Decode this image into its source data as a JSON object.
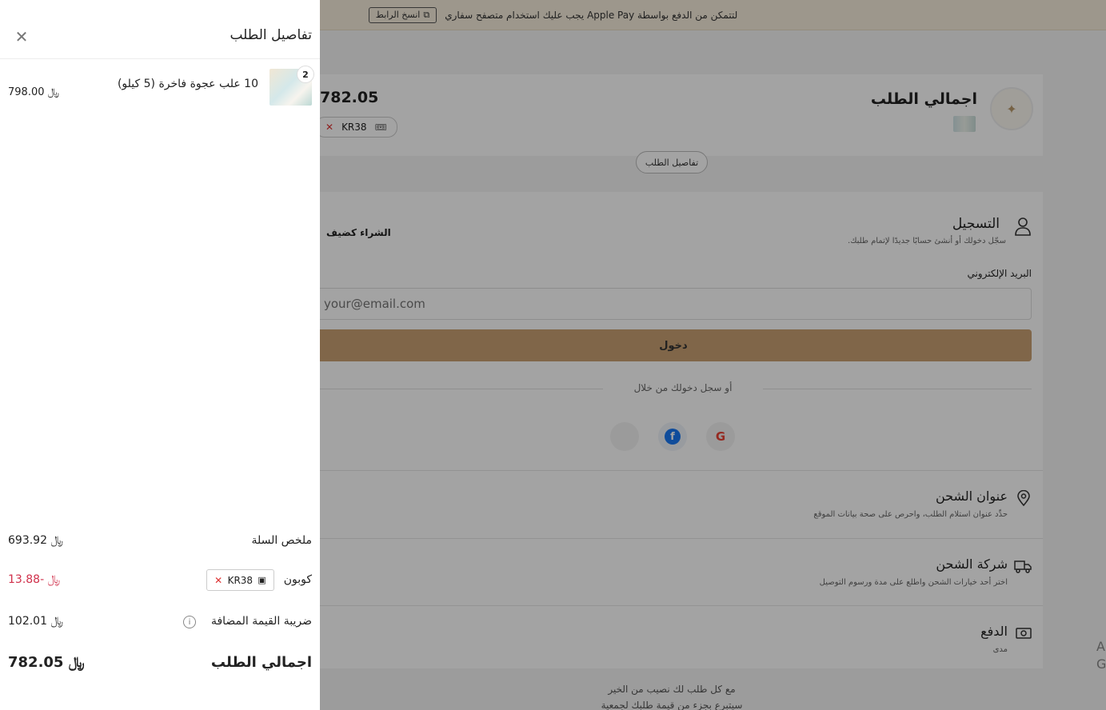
{
  "banner": {
    "message": "لتتمكن من الدفع بواسطة Apple Pay يجب عليك استخدام متصفح سفاري",
    "copy_link_label": "انسخ الرابط"
  },
  "order_summary": {
    "title": "اجمالي الطلب",
    "total": "782.05",
    "coupon_code": "KR38",
    "details_button": "تفاصيل الطلب"
  },
  "registration": {
    "title": "التسجيل",
    "subtitle": "سجّل دخولك أو أنشئ حسابًا جديدًا لإتمام طلبك.",
    "guest_label": "الشراء كضيف",
    "email_label": "البريد الإلكتروني",
    "email_placeholder": "your@email.com",
    "login_button": "دخول",
    "or_text": "أو سجل دخولك من خلال"
  },
  "sections": [
    {
      "title": "عنوان الشحن",
      "subtitle": "حدِّد عنوان استلام الطلب، واحرص على صحة بيانات الموقع"
    },
    {
      "title": "شركة الشحن",
      "subtitle": "اختر أحد خيارات الشحن واطلع على مدة ورسوم التوصيل"
    },
    {
      "title": "الدفع",
      "subtitle": "مدى"
    }
  ],
  "footer": {
    "line1": "مع كل طلب لك نصيب من الخير",
    "line2": "سيتبرع بجزء من قيمة طلبك لجمعية ركن الحوار"
  },
  "edge_text": "A G",
  "drawer": {
    "title": "تفاصيل الطلب",
    "item": {
      "quantity": "2",
      "name": "10 علب عجوة فاخرة (5 كيلو)",
      "price": "798.00"
    },
    "cart_summary_label": "ملخص السلة",
    "cart_summary_value": "693.92",
    "coupon_label": "كوبون",
    "coupon_code": "KR38",
    "coupon_value": "-13.88",
    "vat_label": "ضريبة القيمة المضافة",
    "vat_value": "102.01",
    "total_label": "اجمالي الطلب",
    "total_value": "782.05",
    "currency_symbol": "﷼"
  },
  "colors": {
    "accent": "#c8a073",
    "banner_bg": "#f6eddc",
    "negative": "#d0304b"
  }
}
